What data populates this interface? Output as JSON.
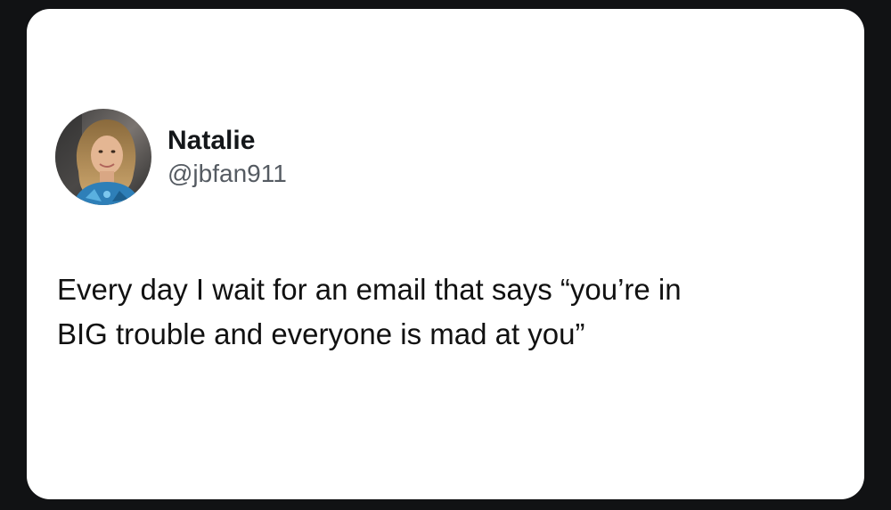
{
  "post": {
    "author": {
      "display_name": "Natalie",
      "handle": "@jbfan911",
      "avatar": "profile-photo"
    },
    "text_line_1": "Every day I wait for an email that says “you’re in",
    "text_line_2": "BIG trouble and everyone is mad at you”"
  },
  "colors": {
    "frame_background": "#111214",
    "card_background": "#ffffff",
    "text_primary": "#111111",
    "text_secondary": "#555b62"
  }
}
